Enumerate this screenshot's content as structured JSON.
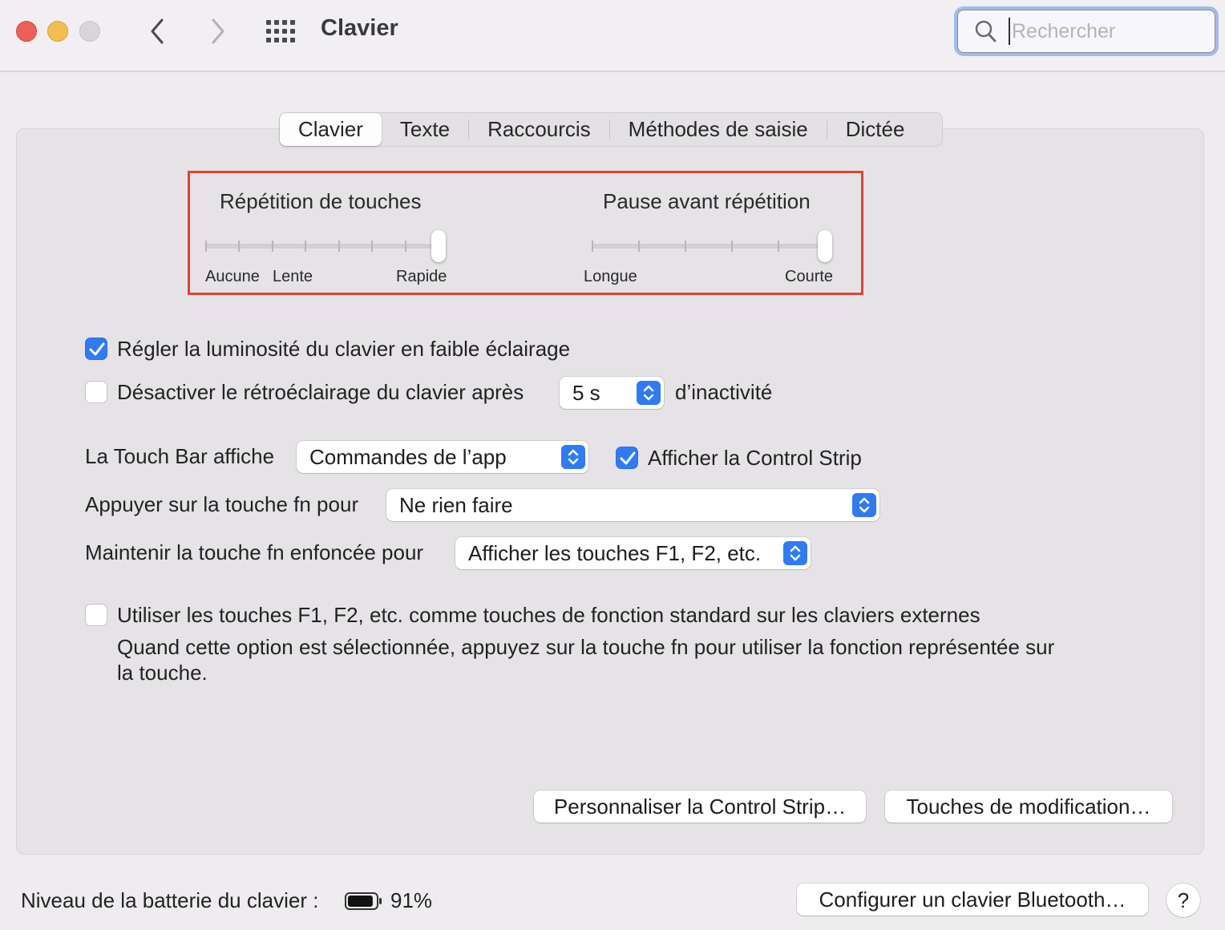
{
  "window": {
    "title": "Clavier",
    "search_placeholder": "Rechercher"
  },
  "tabs": [
    {
      "label": "Clavier",
      "active": true
    },
    {
      "label": "Texte",
      "active": false
    },
    {
      "label": "Raccourcis",
      "active": false
    },
    {
      "label": "Méthodes de saisie",
      "active": false
    },
    {
      "label": "Dictée",
      "active": false
    }
  ],
  "sliders": {
    "repeat": {
      "title": "Répétition de touches",
      "labels": [
        "Aucune",
        "Lente",
        "Rapide"
      ],
      "steps": 8,
      "value_index": 7
    },
    "delay": {
      "title": "Pause avant répétition",
      "labels": [
        "Longue",
        "Courte"
      ],
      "steps": 6,
      "value_index": 5
    }
  },
  "options": {
    "brightness": {
      "label": "Régler la luminosité du clavier en faible éclairage",
      "checked": true
    },
    "backlight": {
      "label": "Désactiver le rétroéclairage du clavier après",
      "checked": false,
      "value": "5 s",
      "suffix": "d’inactivité"
    },
    "touchbar": {
      "label": "La Touch Bar affiche",
      "value": "Commandes de l’app"
    },
    "control_strip": {
      "label": "Afficher la Control Strip",
      "checked": true
    },
    "fn_press": {
      "label": "Appuyer sur la touche fn pour",
      "value": "Ne rien faire"
    },
    "fn_hold": {
      "label": "Maintenir la touche fn enfoncée pour",
      "value": "Afficher les touches F1, F2, etc."
    },
    "fkeys": {
      "label": "Utiliser les touches F1, F2, etc. comme touches de fonction standard sur les claviers externes",
      "description_line1": "Quand cette option est sélectionnée, appuyez sur la touche fn pour utiliser la fonction représentée sur",
      "description_line2": "la touche.",
      "checked": false
    }
  },
  "buttons": {
    "customize_strip": "Personnaliser la Control Strip…",
    "modifier_keys": "Touches de modification…",
    "bluetooth": "Configurer un clavier Bluetooth…",
    "help": "?"
  },
  "footer": {
    "battery_label": "Niveau de la batterie du clavier :",
    "battery_value": "91%",
    "battery_level": 0.91
  },
  "colors": {
    "accent": "#2f7bf6",
    "highlight_box": "#e0442e"
  }
}
